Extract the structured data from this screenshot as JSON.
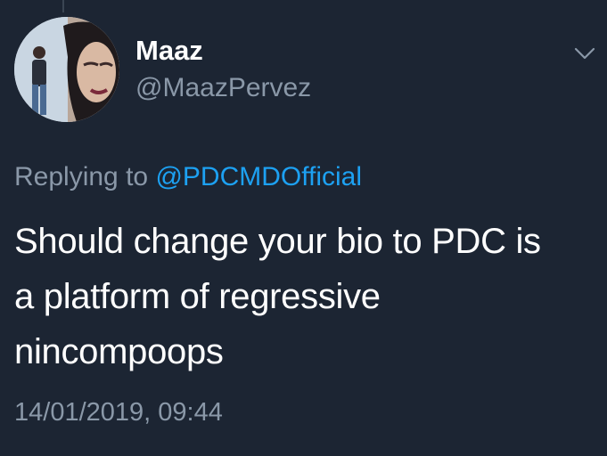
{
  "tweet": {
    "author": {
      "display_name": "Maaz",
      "handle": "@MaazPervez",
      "avatar": "profile-photo"
    },
    "replying_to": {
      "prefix": "Replying to",
      "mention": "@PDCMDOfficial"
    },
    "text_lines": [
      "Should change your bio to PDC is",
      "a platform of regressive",
      "nincompoops"
    ],
    "timestamp": "14/01/2019, 09:44",
    "menu_icon": "chevron-down-icon"
  },
  "colors": {
    "background": "#1c2533",
    "primary_text": "#ffffff",
    "secondary_text": "#8a98a8",
    "accent": "#1da1f2"
  }
}
